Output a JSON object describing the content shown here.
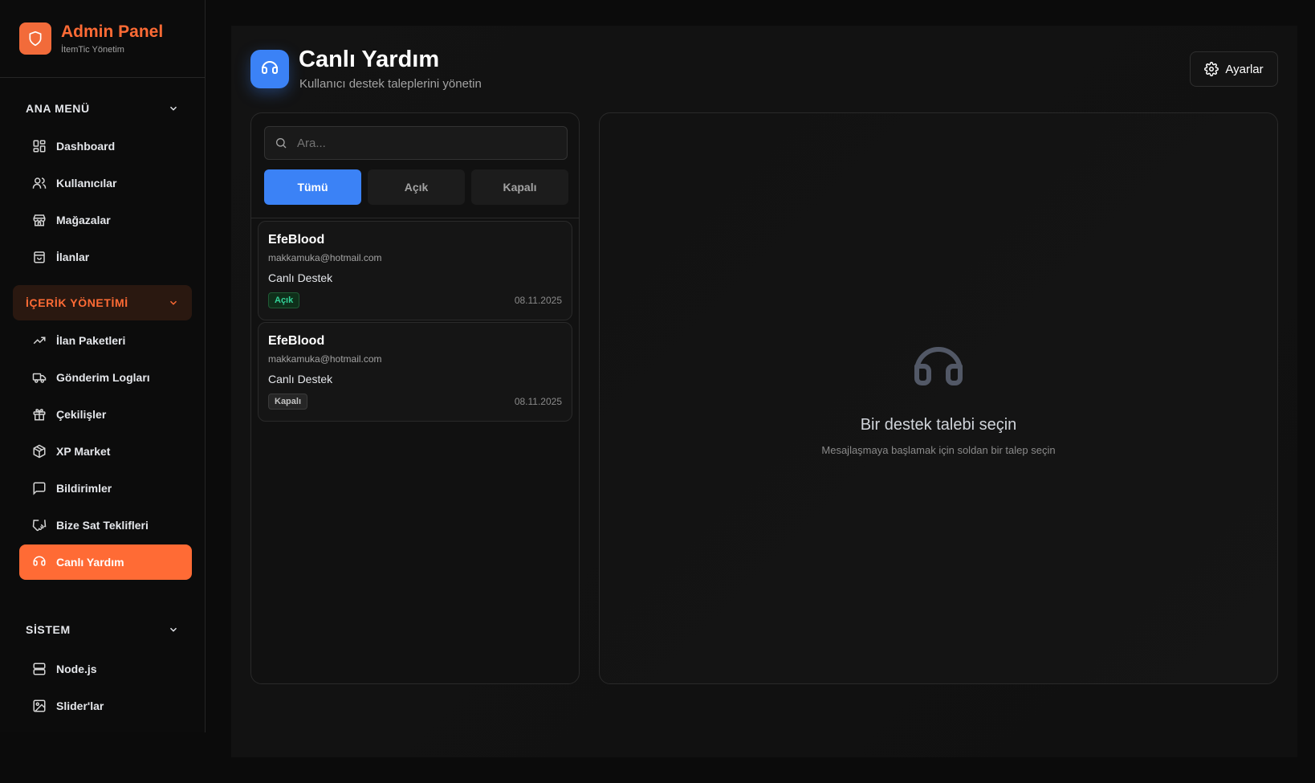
{
  "sidebar": {
    "brand": {
      "title": "Admin Panel",
      "subtitle": "İtemTic Yönetim"
    },
    "sections": [
      {
        "title": "ANA MENÜ",
        "items": [
          "Dashboard",
          "Kullanıcılar",
          "Mağazalar",
          "İlanlar"
        ]
      },
      {
        "title": "İÇERİK YÖNETİMİ",
        "items": [
          "İlan Paketleri",
          "Gönderim Logları",
          "Çekilişler",
          "XP Market",
          "Bildirimler",
          "Bize Sat Teklifleri",
          "Canlı Yardım"
        ]
      },
      {
        "title": "SİSTEM",
        "items": [
          "Node.js",
          "Slider'lar"
        ]
      }
    ]
  },
  "header": {
    "title": "Canlı Yardım",
    "subtitle": "Kullanıcı destek taleplerini yönetin",
    "settings_label": "Ayarlar"
  },
  "search": {
    "placeholder": "Ara..."
  },
  "filters": [
    "Tümü",
    "Açık",
    "Kapalı"
  ],
  "tickets": [
    {
      "name": "EfeBlood",
      "email": "makkamuka@hotmail.com",
      "subject": "Canlı Destek",
      "status": "Açık",
      "date": "08.11.2025"
    },
    {
      "name": "EfeBlood",
      "email": "makkamuka@hotmail.com",
      "subject": "Canlı Destek",
      "status": "Kapalı",
      "date": "08.11.2025"
    }
  ],
  "empty_state": {
    "title": "Bir destek talebi seçin",
    "subtitle": "Mesajlaşmaya başlamak için soldan bir talep seçin"
  },
  "colors": {
    "accent": "#ff6b35",
    "primary": "#3b82f6",
    "open": "#34d399"
  }
}
